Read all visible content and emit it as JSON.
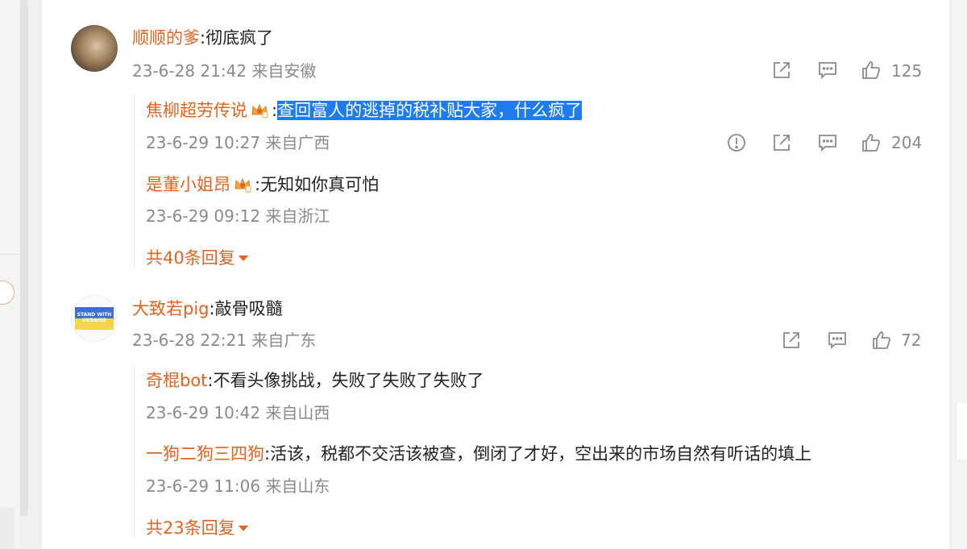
{
  "comments": [
    {
      "user": "顺顺的爹",
      "text": "彻底疯了",
      "meta": "23-6-28 21:42 来自安徽",
      "likes": "125",
      "replies": [
        {
          "user": "焦柳超劳传说",
          "text": "查回富人的逃掉的税补贴大家，什么疯了",
          "meta": "23-6-29 10:27 来自广西",
          "likes": "204"
        },
        {
          "user": "是董小姐昂",
          "text": "无知如你真可怕",
          "meta": "23-6-29 09:12 来自浙江"
        }
      ],
      "more_label": "共40条回复"
    },
    {
      "user": "大致若pig",
      "text": "敲骨吸髓",
      "meta": "23-6-28 22:21 来自广东",
      "likes": "72",
      "avatar_text": "STAND WITH UKRAINE",
      "replies": [
        {
          "user": "奇棍bot",
          "text": "不看头像挑战，失败了失败了失败了",
          "meta": "23-6-29 10:42 来自山西"
        },
        {
          "user": "一狗二狗三四狗",
          "text": "活该，税都不交活该被查，倒闭了才好，空出来的市场自然有听话的填上",
          "meta": "23-6-29 11:06 来自山东"
        }
      ],
      "more_label": "共23条回复"
    }
  ],
  "colors": {
    "username": "#e5631f",
    "meta": "#8a8a8a",
    "highlight": "#1e7bf0"
  },
  "icons": [
    "share-icon",
    "comment-icon",
    "like-icon",
    "report-icon",
    "crown-icon",
    "caret-down-icon"
  ]
}
